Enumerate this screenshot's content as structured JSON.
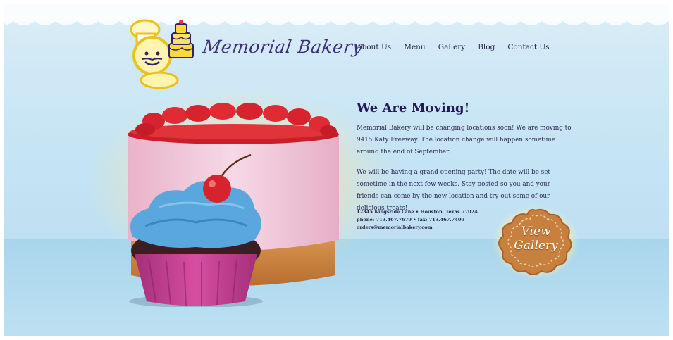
{
  "header": {
    "brand_name": "Memorial Bakery",
    "nav": [
      "About Us",
      "Menu",
      "Gallery",
      "Blog",
      "Contact Us"
    ]
  },
  "main": {
    "headline": "We Are Moving!",
    "paragraphs": [
      "Memorial Bakery will be changing locations soon! We are moving to 9415 Katy Freeway. The location change will happen sometime around the end of September.",
      "We will be having a grand opening party! The date will be set sometime in the next few weeks. Stay posted so you and your friends can come by the new location and try out some of our delicious treats!"
    ],
    "contact": {
      "address": "12345 Kingsride Lane • Houston, Texas 77024",
      "phone_fax": "phone: 713.467.7679 • fax: 713.467.7409",
      "email": "orders@memorialbakery.com"
    },
    "gallery_button": {
      "line1": "View",
      "line2": "Gallery"
    }
  },
  "colors": {
    "sky": "#c6e4f4",
    "floor": "#a9d5ec",
    "heading": "#231a5c",
    "brand": "#3d2f7e",
    "cookie": "#c8803f",
    "cake_pink": "#f3cfe0",
    "cupcake_frosting": "#5aa7dd",
    "cupcake_wrapper": "#c23d90"
  },
  "icons": [
    "baker-logo-icon",
    "cake-illustration",
    "cupcake-illustration",
    "cookie-badge-icon"
  ]
}
